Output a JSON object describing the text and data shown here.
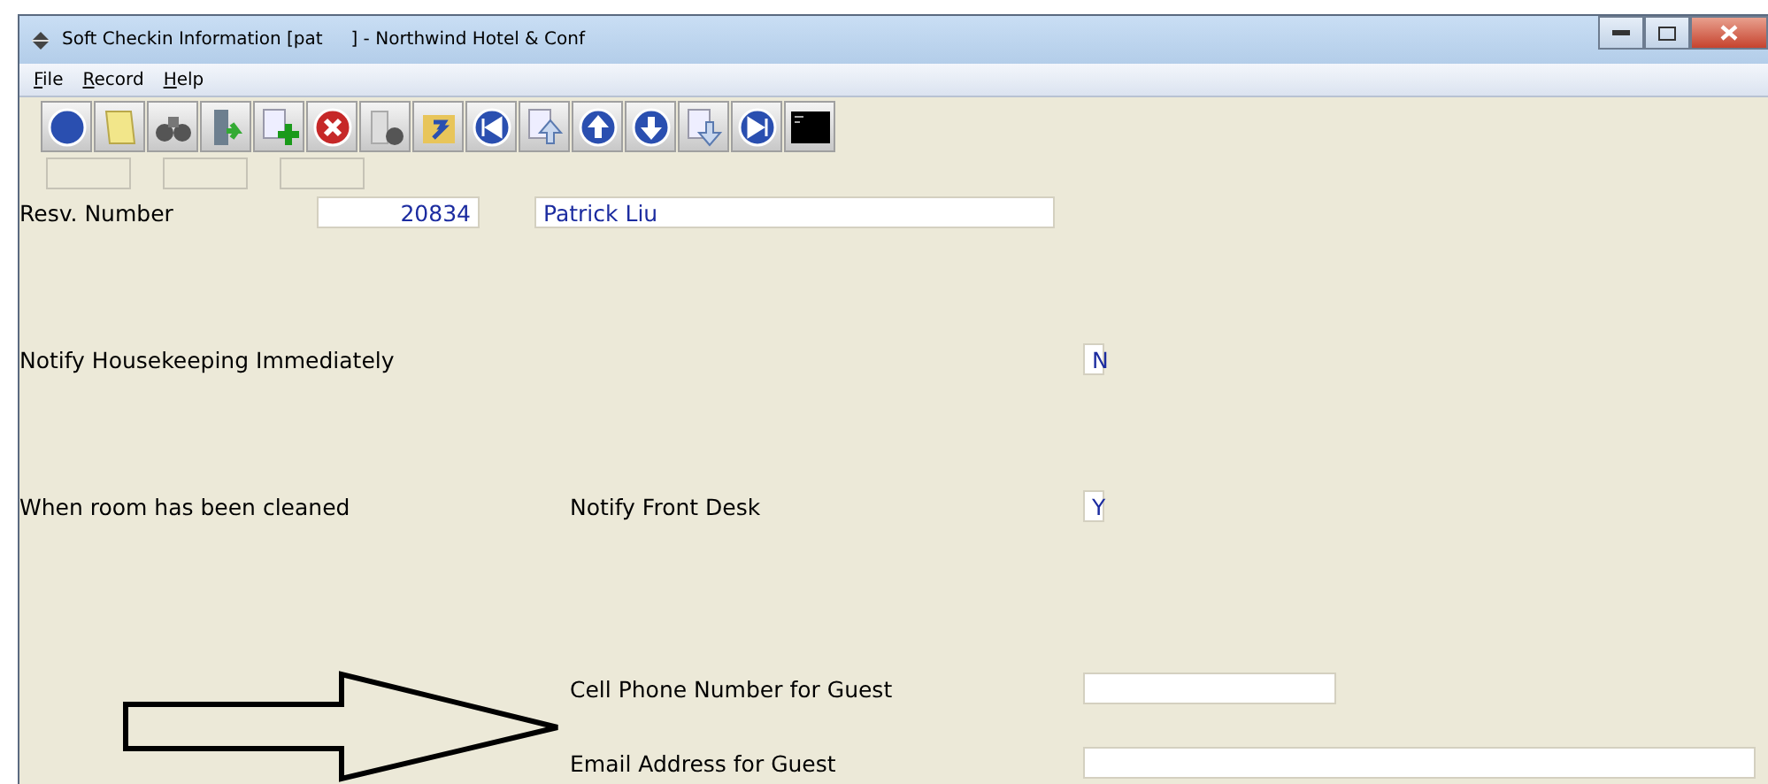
{
  "window": {
    "title": "Soft Checkin Information [pat     ] - Northwind Hotel & Conf"
  },
  "menu": [
    {
      "label": "File"
    },
    {
      "label": "Record"
    },
    {
      "label": "Help"
    }
  ],
  "form": {
    "resv_label": "Resv. Number",
    "resv_number": "20834",
    "guest_name": "Patrick Liu",
    "housekeeping_label": "Notify Housekeeping Immediately",
    "housekeeping_value": "N",
    "cleaned_label": "When room has been cleaned",
    "front_desk_label": "Notify Front Desk",
    "front_desk_value": "Y",
    "cell_label": "Cell Phone Number for Guest",
    "email_label": "Email Address for Guest"
  }
}
